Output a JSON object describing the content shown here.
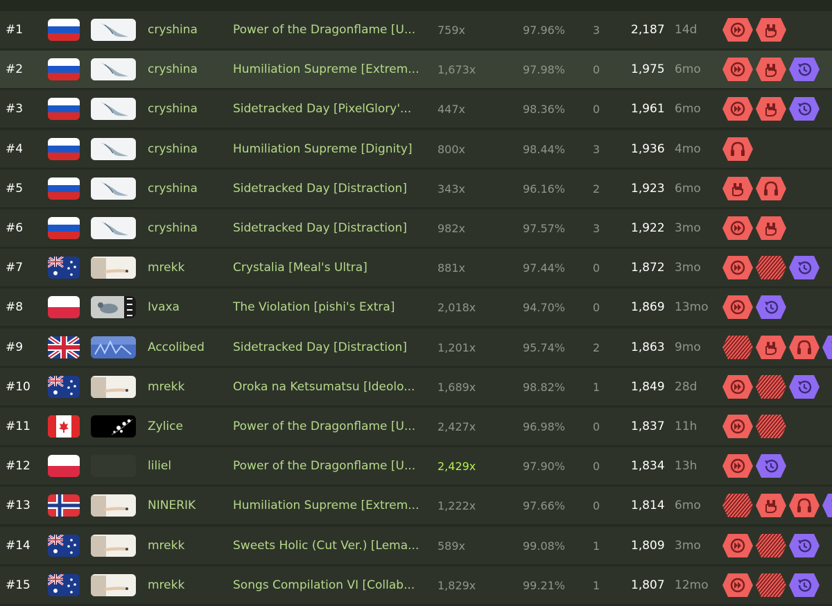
{
  "colors": {
    "mod_red": "#f0605c",
    "mod_purple": "#8e6bf2",
    "player_text": "#b7d98a",
    "muted_text": "#8e9788",
    "highlight_combo": "#b6f04a"
  },
  "rows": [
    {
      "rank": "#1",
      "flag": "russia-flag",
      "avatar": "bird-avatar",
      "player": "cryshina",
      "beatmap": "Power of the Dragonflame [U...",
      "combo": "759x",
      "accuracy": "97.96%",
      "misses": "3",
      "pp": "2,187",
      "age": "14d",
      "mods": [
        "double-time-icon",
        "hard-rock-icon"
      ]
    },
    {
      "rank": "#2",
      "flag": "russia-flag",
      "avatar": "bird-avatar",
      "player": "cryshina",
      "beatmap": "Humiliation Supreme [Extrem...",
      "combo": "1,673x",
      "accuracy": "97.98%",
      "misses": "0",
      "pp": "1,975",
      "age": "6mo",
      "mods": [
        "double-time-icon",
        "hard-rock-icon",
        "rewind-icon"
      ]
    },
    {
      "rank": "#3",
      "flag": "russia-flag",
      "avatar": "bird-avatar",
      "player": "cryshina",
      "beatmap": "Sidetracked Day [PixelGlory'...",
      "combo": "447x",
      "accuracy": "98.36%",
      "misses": "0",
      "pp": "1,961",
      "age": "6mo",
      "mods": [
        "double-time-icon",
        "hard-rock-icon",
        "rewind-icon"
      ]
    },
    {
      "rank": "#4",
      "flag": "russia-flag",
      "avatar": "bird-avatar",
      "player": "cryshina",
      "beatmap": "Humiliation Supreme [Dignity]",
      "combo": "800x",
      "accuracy": "98.44%",
      "misses": "3",
      "pp": "1,936",
      "age": "4mo",
      "mods": [
        "headphones-icon"
      ]
    },
    {
      "rank": "#5",
      "flag": "russia-flag",
      "avatar": "bird-avatar",
      "player": "cryshina",
      "beatmap": "Sidetracked Day [Distraction]",
      "combo": "343x",
      "accuracy": "96.16%",
      "misses": "2",
      "pp": "1,923",
      "age": "6mo",
      "mods": [
        "hard-rock-icon",
        "headphones-icon"
      ]
    },
    {
      "rank": "#6",
      "flag": "russia-flag",
      "avatar": "bird-avatar",
      "player": "cryshina",
      "beatmap": "Sidetracked Day [Distraction]",
      "combo": "982x",
      "accuracy": "97.57%",
      "misses": "3",
      "pp": "1,922",
      "age": "3mo",
      "mods": [
        "double-time-icon",
        "hard-rock-icon"
      ]
    },
    {
      "rank": "#7",
      "flag": "australia-flag",
      "avatar": "arm-avatar",
      "player": "mrekk",
      "beatmap": "Crystalia [Meal's Ultra]",
      "combo": "881x",
      "accuracy": "97.44%",
      "misses": "0",
      "pp": "1,872",
      "age": "3mo",
      "mods": [
        "double-time-icon",
        "hidden-stripes-icon",
        "rewind-icon"
      ]
    },
    {
      "rank": "#8",
      "flag": "poland-flag",
      "avatar": "pigeon-avatar",
      "player": "Ivaxa",
      "beatmap": "The Violation [pishi's Extra]",
      "combo": "2,018x",
      "accuracy": "94.70%",
      "misses": "0",
      "pp": "1,869",
      "age": "13mo",
      "mods": [
        "double-time-icon",
        "rewind-icon"
      ]
    },
    {
      "rank": "#9",
      "flag": "uk-flag",
      "avatar": "blue-avatar",
      "player": "Accolibed",
      "beatmap": "Sidetracked Day [Distraction]",
      "combo": "1,201x",
      "accuracy": "95.74%",
      "misses": "2",
      "pp": "1,863",
      "age": "9mo",
      "mods": [
        "hidden-stripes-icon",
        "hard-rock-icon",
        "headphones-icon",
        "rewind-icon"
      ]
    },
    {
      "rank": "#10",
      "flag": "australia-flag",
      "avatar": "arm-avatar",
      "player": "mrekk",
      "beatmap": "Oroka na Ketsumatsu [Ideolo...",
      "combo": "1,689x",
      "accuracy": "98.82%",
      "misses": "1",
      "pp": "1,849",
      "age": "28d",
      "mods": [
        "double-time-icon",
        "hidden-stripes-icon",
        "rewind-icon"
      ]
    },
    {
      "rank": "#11",
      "flag": "canada-flag",
      "avatar": "flower-avatar",
      "player": "Zylice",
      "beatmap": "Power of the Dragonflame [U...",
      "combo": "2,427x",
      "accuracy": "96.98%",
      "misses": "0",
      "pp": "1,837",
      "age": "11h",
      "mods": [
        "double-time-icon",
        "hidden-stripes-icon"
      ]
    },
    {
      "rank": "#12",
      "flag": "poland-flag",
      "avatar": "blank-avatar",
      "player": "liliel",
      "beatmap": "Power of the Dragonflame [U...",
      "combo": "2,429x",
      "accuracy": "97.90%",
      "misses": "0",
      "pp": "1,834",
      "age": "13h",
      "mods": [
        "double-time-icon",
        "rewind-icon"
      ]
    },
    {
      "rank": "#13",
      "flag": "norway-flag",
      "avatar": "arm-avatar",
      "player": "NINERIK",
      "beatmap": "Humiliation Supreme [Extrem...",
      "combo": "1,222x",
      "accuracy": "97.66%",
      "misses": "0",
      "pp": "1,814",
      "age": "6mo",
      "mods": [
        "hidden-stripes-icon",
        "hard-rock-icon",
        "headphones-icon",
        "rewind-icon"
      ]
    },
    {
      "rank": "#14",
      "flag": "australia-flag",
      "avatar": "arm-avatar",
      "player": "mrekk",
      "beatmap": "Sweets Holic (Cut Ver.) [Lema...",
      "combo": "589x",
      "accuracy": "99.08%",
      "misses": "1",
      "pp": "1,809",
      "age": "3mo",
      "mods": [
        "double-time-icon",
        "hidden-stripes-icon",
        "rewind-icon"
      ]
    },
    {
      "rank": "#15",
      "flag": "australia-flag",
      "avatar": "arm-avatar",
      "player": "mrekk",
      "beatmap": "Songs Compilation VI [Collab...",
      "combo": "1,829x",
      "accuracy": "99.21%",
      "misses": "1",
      "pp": "1,807",
      "age": "12mo",
      "mods": [
        "double-time-icon",
        "hidden-stripes-icon",
        "rewind-icon"
      ]
    }
  ]
}
